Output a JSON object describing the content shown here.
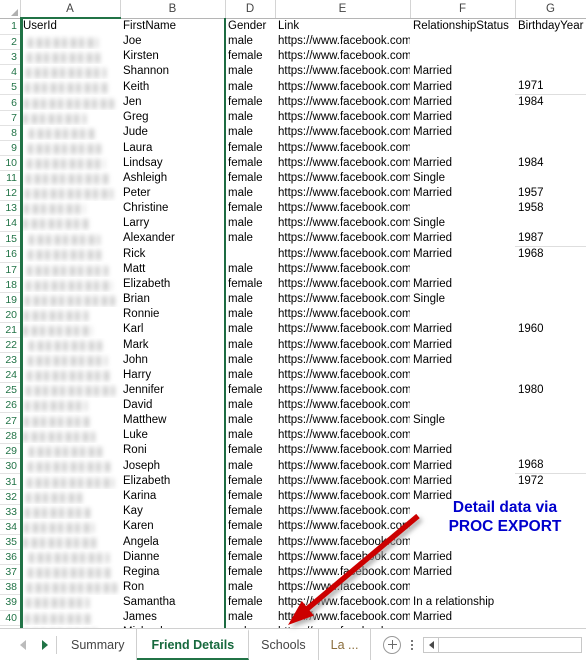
{
  "app": {
    "type": "spreadsheet",
    "active_sheet": "Friend Details"
  },
  "grid": {
    "column_headers": [
      "A",
      "B",
      "D",
      "E",
      "F",
      "G"
    ],
    "hidden_columns": [
      "C"
    ],
    "header_row_number": "1",
    "headers": {
      "a": "UserId",
      "b": "FirstName",
      "d": "Gender",
      "e": "Link",
      "f": "RelationshipStatus",
      "g": "BirthdayYear"
    },
    "userid_redacted": true,
    "rows": [
      {
        "n": "2",
        "userid": "",
        "first": "Joe",
        "gender": "male",
        "link": "https://www.facebook.com/jscat",
        "status": "",
        "year": ""
      },
      {
        "n": "3",
        "userid": "",
        "first": "Kirsten",
        "gender": "female",
        "link": "https://www.facebook.com/khan",
        "status": "",
        "year": ""
      },
      {
        "n": "4",
        "userid": "",
        "first": "Shannon",
        "gender": "male",
        "link": "https://www.facebook.com/sqth",
        "status": "Married",
        "year": ""
      },
      {
        "n": "5",
        "userid": "",
        "first": "Keith",
        "gender": "male",
        "link": "https://www.facebook.com/k.d.b",
        "status": "Married",
        "year": "1971"
      },
      {
        "n": "6",
        "userid": "",
        "first": "Jen",
        "gender": "female",
        "link": "https://www.facebook.com/jen.y",
        "status": "Married",
        "year": "1984"
      },
      {
        "n": "7",
        "userid": "",
        "first": "Greg",
        "gender": "male",
        "link": "https://www.facebook.com/grafg",
        "status": "Married",
        "year": ""
      },
      {
        "n": "8",
        "userid": "",
        "first": "Jude",
        "gender": "male",
        "link": "https://www.facebook.com/judel",
        "status": "Married",
        "year": ""
      },
      {
        "n": "9",
        "userid": "",
        "first": "Laura",
        "gender": "female",
        "link": "https://www.facebook.com/laura",
        "status": "",
        "year": ""
      },
      {
        "n": "10",
        "userid": "",
        "first": "Lindsay",
        "gender": "female",
        "link": "https://www.facebook.com/linds",
        "status": "Married",
        "year": "1984"
      },
      {
        "n": "11",
        "userid": "",
        "first": "Ashleigh",
        "gender": "female",
        "link": "https://www.facebook.com/wilke",
        "status": "Single",
        "year": ""
      },
      {
        "n": "12",
        "userid": "",
        "first": "Peter",
        "gender": "male",
        "link": "https://www.facebook.com/pete",
        "status": "Married",
        "year": "1957"
      },
      {
        "n": "13",
        "userid": "",
        "first": "Christine",
        "gender": "female",
        "link": "https://www.facebook.com/chris",
        "status": "",
        "year": "1958"
      },
      {
        "n": "14",
        "userid": "",
        "first": "Larry",
        "gender": "male",
        "link": "https://www.facebook.com/larry",
        "status": "Single",
        "year": ""
      },
      {
        "n": "15",
        "userid": "",
        "first": "Alexander",
        "gender": "male",
        "link": "https://www.facebook.com/alex.",
        "status": "Married",
        "year": "1987"
      },
      {
        "n": "16",
        "userid": "",
        "first": "Rick",
        "gender": "",
        "link": "https://www.facebook.com/rick.",
        "status": "Married",
        "year": "1968"
      },
      {
        "n": "17",
        "userid": "",
        "first": "Matt",
        "gender": "male",
        "link": "https://www.facebook.com/uppe",
        "status": "",
        "year": ""
      },
      {
        "n": "18",
        "userid": "",
        "first": "Elizabeth",
        "gender": "female",
        "link": "https://www.facebook.com/eliza",
        "status": "Married",
        "year": ""
      },
      {
        "n": "19",
        "userid": "",
        "first": "Brian",
        "gender": "male",
        "link": "https://www.facebook.com/bluer",
        "status": "Single",
        "year": ""
      },
      {
        "n": "20",
        "userid": "",
        "first": "Ronnie",
        "gender": "male",
        "link": "https://www.facebook.com/ronn",
        "status": "",
        "year": ""
      },
      {
        "n": "21",
        "userid": "",
        "first": "Karl",
        "gender": "male",
        "link": "https://www.facebook.com/karl.",
        "status": "Married",
        "year": "1960"
      },
      {
        "n": "22",
        "userid": "",
        "first": "Mark",
        "gender": "male",
        "link": "https://www.facebook.com/mark",
        "status": "Married",
        "year": ""
      },
      {
        "n": "23",
        "userid": "",
        "first": "John",
        "gender": "male",
        "link": "https://www.facebook.com/john.",
        "status": "Married",
        "year": ""
      },
      {
        "n": "24",
        "userid": "",
        "first": "Harry",
        "gender": "male",
        "link": "https://www.facebook.com/hjma",
        "status": "",
        "year": ""
      },
      {
        "n": "25",
        "userid": "",
        "first": "Jennifer",
        "gender": "female",
        "link": "https://www.facebook.com/jenni",
        "status": "",
        "year": "1980"
      },
      {
        "n": "26",
        "userid": "",
        "first": "David",
        "gender": "male",
        "link": "https://www.facebook.com/davi",
        "status": "",
        "year": ""
      },
      {
        "n": "27",
        "userid": "",
        "first": "Matthew",
        "gender": "male",
        "link": "https://www.facebook.com/mattl",
        "status": "Single",
        "year": ""
      },
      {
        "n": "28",
        "userid": "",
        "first": "Luke",
        "gender": "male",
        "link": "https://www.facebook.com/luke.",
        "status": "",
        "year": ""
      },
      {
        "n": "29",
        "userid": "",
        "first": "Roni",
        "gender": "female",
        "link": "https://www.facebook.com/roni.",
        "status": "Married",
        "year": ""
      },
      {
        "n": "30",
        "userid": "",
        "first": "Joseph",
        "gender": "male",
        "link": "https://www.facebook.com/josep",
        "status": "Married",
        "year": "1968"
      },
      {
        "n": "31",
        "userid": "",
        "first": "Elizabeth",
        "gender": "female",
        "link": "https://www.facebook.com/eliza",
        "status": "Married",
        "year": "1972"
      },
      {
        "n": "32",
        "userid": "",
        "first": "Karina",
        "gender": "female",
        "link": "https://www.facebook.com/karin",
        "status": "Married",
        "year": ""
      },
      {
        "n": "33",
        "userid": "",
        "first": "Kay",
        "gender": "female",
        "link": "https://www.facebook.com/kay.e",
        "status": "",
        "year": ""
      },
      {
        "n": "34",
        "userid": "",
        "first": "Karen",
        "gender": "female",
        "link": "https://www.facebook.com/kare",
        "status": "",
        "year": ""
      },
      {
        "n": "35",
        "userid": "",
        "first": "Angela",
        "gender": "female",
        "link": "https://www.facebook.com/ange",
        "status": "",
        "year": ""
      },
      {
        "n": "36",
        "userid": "",
        "first": "Dianne",
        "gender": "female",
        "link": "https://www.facebook.com/dian",
        "status": "Married",
        "year": ""
      },
      {
        "n": "37",
        "userid": "",
        "first": "Regina",
        "gender": "female",
        "link": "https://www.facebook.com/regir",
        "status": "Married",
        "year": ""
      },
      {
        "n": "38",
        "userid": "",
        "first": "Ron",
        "gender": "male",
        "link": "https://www.facebook.com/ron.s",
        "status": "",
        "year": ""
      },
      {
        "n": "39",
        "userid": "",
        "first": "Samantha",
        "gender": "female",
        "link": "https://www.facebook.com/sam",
        "status": "In a relationship",
        "year": ""
      },
      {
        "n": "40",
        "userid": "",
        "first": "James",
        "gender": "male",
        "link": "https://www.facebook.com/Jone",
        "status": "Married",
        "year": ""
      },
      {
        "n": "41",
        "userid": "",
        "first": "Michael",
        "gender": "male",
        "link": "https://www.facebook.com/mich",
        "status": "",
        "year": ""
      }
    ]
  },
  "annotation": {
    "line1": "Detail data via",
    "line2": "PROC EXPORT",
    "text_color": "#0000cc",
    "arrow_color": "#cc0000"
  },
  "tabbar": {
    "prev_label": "previous-sheet",
    "next_label": "next-sheet",
    "tabs": [
      {
        "label": "Summary",
        "active": false
      },
      {
        "label": "Friend Details",
        "active": true
      },
      {
        "label": "Schools",
        "active": false
      },
      {
        "label": "La ...",
        "active": false
      }
    ],
    "add_sheet_label": "+",
    "active_tab_color": "#16693d"
  }
}
